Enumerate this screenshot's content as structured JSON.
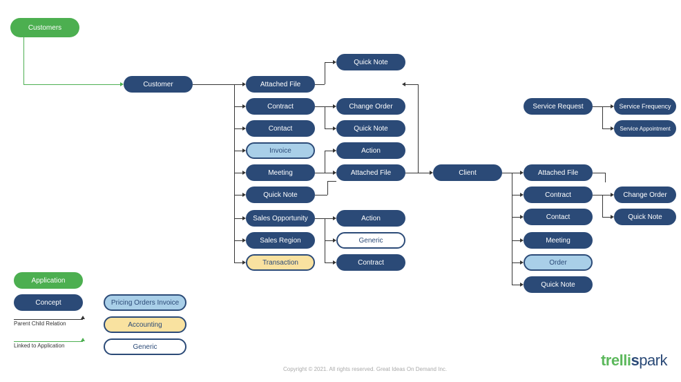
{
  "root": {
    "customers": "Customers"
  },
  "customer": "Customer",
  "col1": {
    "attachedFile": "Attached File",
    "contract": "Contract",
    "contact": "Contact",
    "invoice": "Invoice",
    "meeting": "Meeting",
    "quickNote": "Quick Note",
    "salesOpportunity": "Sales Opportunity",
    "salesRegion": "Sales Region",
    "transaction": "Transaction"
  },
  "col2": {
    "quickNote1": "Quick Note",
    "changeOrder": "Change Order",
    "quickNote2": "Quick Note",
    "action1": "Action",
    "attachedFile": "Attached File",
    "action2": "Action",
    "generic": "Generic",
    "contract": "Contract"
  },
  "client": "Client",
  "clientCol": {
    "attachedFile": "Attached File",
    "contract": "Contract",
    "contact": "Contact",
    "meeting": "Meeting",
    "order": "Order",
    "quickNote": "Quick Note"
  },
  "clientSub": {
    "changeOrder": "Change Order",
    "quickNote": "Quick Note"
  },
  "serviceRequest": "Service Request",
  "serviceCol": {
    "frequency": "Service Frequency",
    "appointment": "Service Appointment"
  },
  "legend": {
    "application": "Application",
    "concept": "Concept",
    "pricing": "Pricing Orders Invoice",
    "accounting": "Accounting",
    "generic": "Generic",
    "parentChild": "Parent Child Relation",
    "linked": "Linked to Application"
  },
  "footer": "Copyright © 2021. All rights reserved. Great Ideas On Demand Inc.",
  "logo": {
    "p1": "trelli",
    "p2": "s",
    "p3": "park"
  }
}
